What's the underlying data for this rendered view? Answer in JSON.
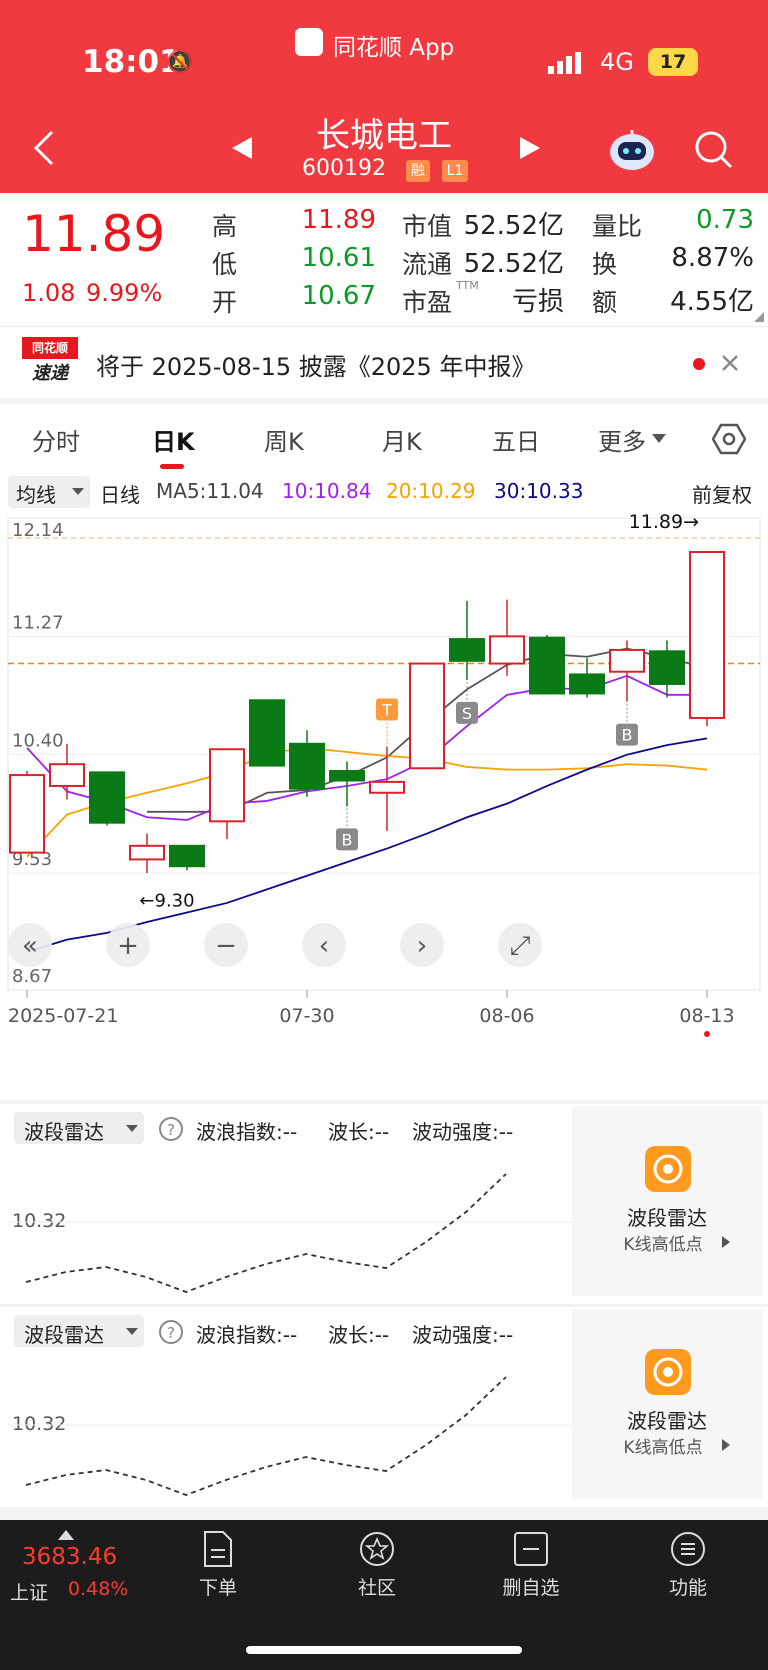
{
  "status_bar": {
    "time": "18:01",
    "app": "同花顺 App",
    "network": "4G",
    "battery": "17"
  },
  "header": {
    "title": "长城电工",
    "code": "600192",
    "tag1": "融",
    "tag2": "L1"
  },
  "quote": {
    "price": "11.89",
    "change": "1.08",
    "change_pct": "9.99%",
    "high_label": "高",
    "high": "11.89",
    "low_label": "低",
    "low": "10.61",
    "open_label": "开",
    "open": "10.67",
    "mcap_label": "市值",
    "mcap": "52.52亿",
    "float_label": "流通",
    "float": "52.52亿",
    "pe_label": "市盈",
    "pe_sup": "TTM",
    "pe": "亏损",
    "vr_label": "量比",
    "vr": "0.73",
    "turn_label": "换",
    "turn": "8.87%",
    "amt_label": "额",
    "amt": "4.55亿"
  },
  "news": {
    "logo_top": "同花顺",
    "logo_bottom": "速递",
    "text": "将于 2025-08-15 披露《2025 年中报》"
  },
  "tabs": [
    "分时",
    "日K",
    "周K",
    "月K",
    "五日",
    "更多"
  ],
  "ma_bar": {
    "selector": "均线",
    "period": "日线",
    "ma5": "MA5:11.04",
    "ma10": "10:10.84",
    "ma20": "20:10.29",
    "ma30": "30:10.33",
    "adjust": "前复权"
  },
  "chart_data": {
    "type": "candlestick",
    "y_ticks": [
      "12.14",
      "11.27",
      "10.40",
      "9.53",
      "8.67"
    ],
    "x_ticks": [
      "2025-07-21",
      "07-30",
      "08-06",
      "08-13"
    ],
    "ylim": [
      8.67,
      12.14
    ],
    "candles": [
      {
        "o": 10.25,
        "c": 9.68,
        "h": 10.28,
        "l": 9.68,
        "up": true
      },
      {
        "o": 10.17,
        "c": 10.33,
        "h": 10.48,
        "l": 10.07,
        "up": true
      },
      {
        "o": 10.27,
        "c": 9.9,
        "h": 10.27,
        "l": 9.88,
        "up": false
      },
      {
        "o": 9.63,
        "c": 9.73,
        "h": 9.82,
        "l": 9.53,
        "up": true
      },
      {
        "o": 9.73,
        "c": 9.58,
        "h": 9.73,
        "l": 9.55,
        "up": false
      },
      {
        "o": 9.91,
        "c": 10.44,
        "h": 10.44,
        "l": 9.78,
        "up": true
      },
      {
        "o": 10.8,
        "c": 10.32,
        "h": 10.8,
        "l": 10.32,
        "up": false
      },
      {
        "o": 10.48,
        "c": 10.15,
        "h": 10.58,
        "l": 10.09,
        "up": false
      },
      {
        "o": 10.28,
        "c": 10.21,
        "h": 10.35,
        "l": 10.02,
        "up": false
      },
      {
        "o": 10.12,
        "c": 10.2,
        "h": 10.46,
        "l": 9.84,
        "up": true
      },
      {
        "o": 10.3,
        "c": 11.07,
        "h": 11.07,
        "l": 10.3,
        "up": true
      },
      {
        "o": 11.25,
        "c": 11.09,
        "h": 11.53,
        "l": 10.95,
        "up": false
      },
      {
        "o": 11.07,
        "c": 11.27,
        "h": 11.54,
        "l": 10.98,
        "up": true
      },
      {
        "o": 11.26,
        "c": 10.85,
        "h": 11.28,
        "l": 10.85,
        "up": false
      },
      {
        "o": 10.99,
        "c": 10.85,
        "h": 11.11,
        "l": 10.82,
        "up": false
      },
      {
        "o": 11.01,
        "c": 11.17,
        "h": 11.24,
        "l": 10.79,
        "up": true
      },
      {
        "o": 11.16,
        "c": 10.92,
        "h": 11.24,
        "l": 10.82,
        "up": false
      },
      {
        "o": 10.67,
        "c": 11.89,
        "h": 11.89,
        "l": 10.61,
        "up": true
      }
    ],
    "series": [
      {
        "name": "MA5",
        "color": "#555555",
        "values": [
          null,
          null,
          null,
          9.98,
          9.98,
          9.98,
          10.12,
          10.14,
          10.24,
          10.38,
          10.64,
          10.88,
          11.06,
          11.14,
          11.12,
          11.18,
          11.11,
          11.04
        ]
      },
      {
        "name": "MA10",
        "color": "#a020f0",
        "values": [
          10.45,
          10.13,
          10.05,
          9.94,
          9.92,
          10.04,
          10.06,
          10.13,
          10.17,
          10.22,
          10.36,
          10.61,
          10.84,
          10.89,
          10.88,
          10.98,
          10.84,
          10.84
        ]
      },
      {
        "name": "MA20",
        "color": "#f5a300",
        "values": [
          9.65,
          9.96,
          10.05,
          10.12,
          10.19,
          10.27,
          10.41,
          10.45,
          10.42,
          10.39,
          10.37,
          10.31,
          10.29,
          10.29,
          10.3,
          10.33,
          10.32,
          10.29
        ]
      },
      {
        "name": "MA30",
        "color": "#0a0a8a",
        "values": [
          8.95,
          9.04,
          9.09,
          9.17,
          9.24,
          9.31,
          9.41,
          9.51,
          9.61,
          9.71,
          9.82,
          9.94,
          10.04,
          10.17,
          10.29,
          10.4,
          10.47,
          10.52
        ]
      }
    ],
    "price_line": 11.07,
    "last": "11.89→",
    "low_mark": "←9.30",
    "markers": [
      {
        "text": "B",
        "i": 8
      },
      {
        "text": "T",
        "i": 9
      },
      {
        "text": "S",
        "i": 11
      },
      {
        "text": "B",
        "i": 15
      }
    ]
  },
  "radar1": {
    "selector": "波段雷达",
    "wave": "波浪指数:--",
    "len": "波长:--",
    "strength": "波动强度:--",
    "level": "10.32",
    "card_title": "波段雷达",
    "card_sub": "K线高低点"
  },
  "radar2": {
    "selector": "波段雷达",
    "wave": "波浪指数:--",
    "len": "波长:--",
    "strength": "波动强度:--",
    "level": "10.32",
    "card_title": "波段雷达",
    "card_sub": "K线高低点"
  },
  "bottom": {
    "index_value": "3683.46",
    "index_name": "上证",
    "index_pct": "0.48%",
    "order": "下单",
    "community": "社区",
    "delete": "删自选",
    "func": "功能"
  }
}
